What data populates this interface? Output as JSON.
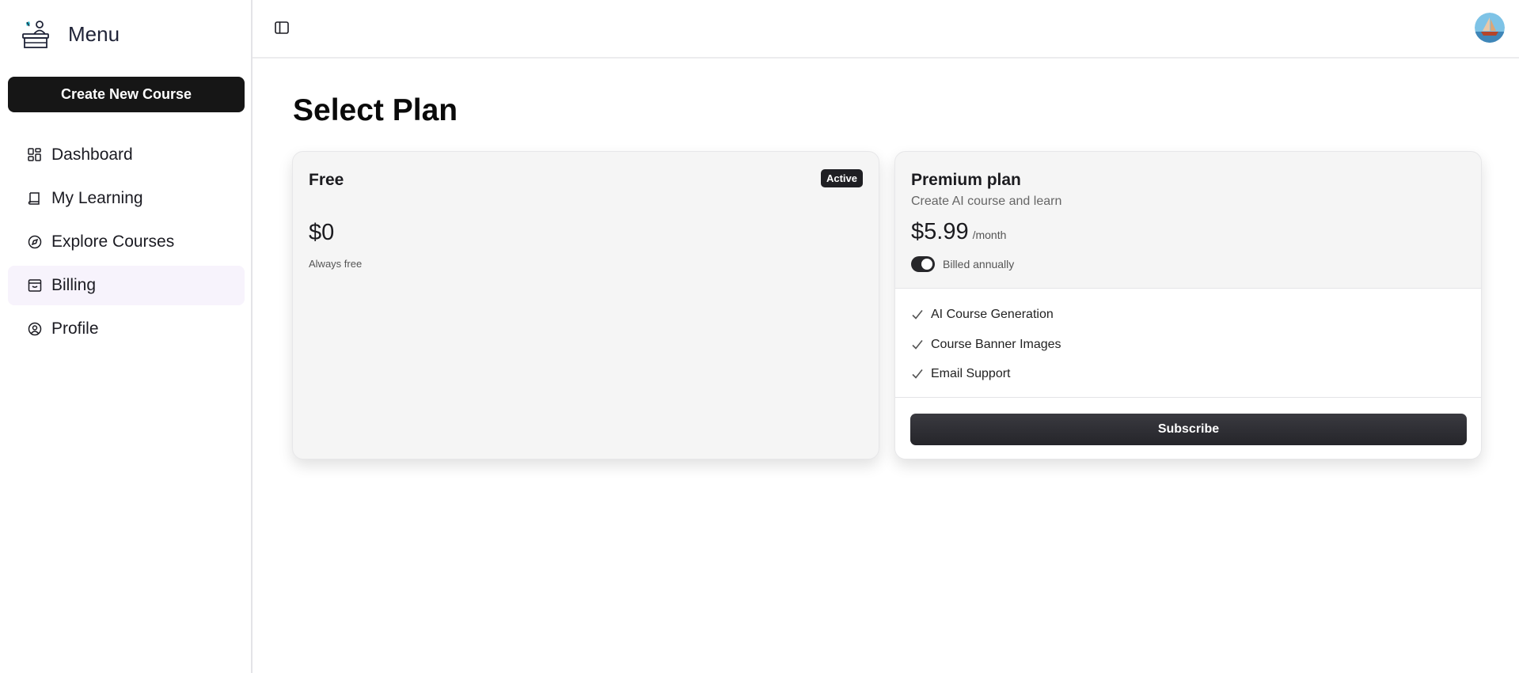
{
  "sidebar": {
    "title": "Menu",
    "create_label": "Create New Course",
    "items": [
      {
        "label": "Dashboard",
        "icon": "dashboard-icon"
      },
      {
        "label": "My Learning",
        "icon": "book-icon"
      },
      {
        "label": "Explore Courses",
        "icon": "compass-icon"
      },
      {
        "label": "Billing",
        "icon": "billing-icon",
        "active": true
      },
      {
        "label": "Profile",
        "icon": "user-circle-icon"
      }
    ]
  },
  "main": {
    "title": "Select Plan"
  },
  "plans": {
    "free": {
      "name": "Free",
      "badge": "Active",
      "price": "$0",
      "note": "Always free"
    },
    "premium": {
      "name": "Premium plan",
      "subtitle": "Create AI course and learn",
      "price": "$5.99",
      "period": "/month",
      "billing_label": "Billed annually",
      "billed_annually": true,
      "features": [
        "AI Course Generation",
        "Course Banner Images",
        "Email Support"
      ],
      "cta": "Subscribe"
    }
  },
  "colors": {
    "primary": "#161616",
    "active_nav_bg": "#f7f3fc",
    "card_bg": "#f5f5f5"
  }
}
